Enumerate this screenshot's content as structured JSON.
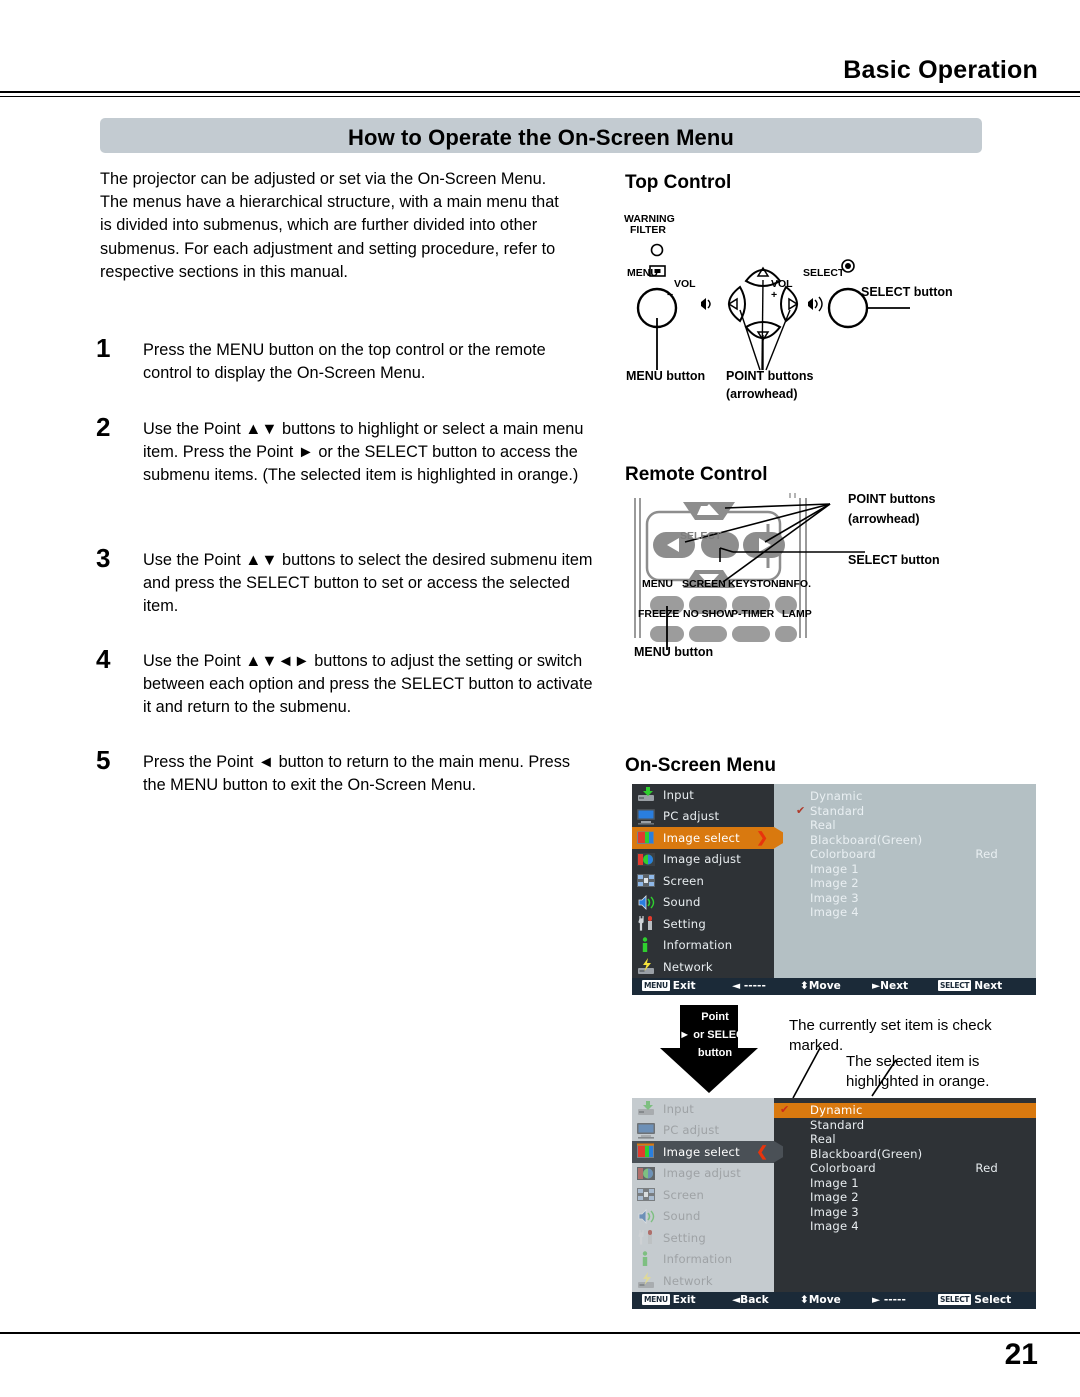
{
  "header": {
    "title": "Basic Operation",
    "banner": "How to Operate the On-Screen Menu"
  },
  "intro": "The projector can be adjusted or set via the On-Screen Menu. The menus have a hierarchical structure, with a main menu that is divided into submenus, which are further divided into other submenus. For each adjustment and setting procedure, refer to respective sections in this manual.",
  "steps": [
    {
      "num": "1",
      "text": "Press the MENU button on the top control or the remote control to display the On-Screen Menu."
    },
    {
      "num": "2",
      "text": "Use the Point ▲▼ buttons to highlight or select a main menu item. Press the Point ► or the SELECT button to access the submenu items. (The selected item is highlighted in orange.)"
    },
    {
      "num": "3",
      "text": "Use the Point ▲▼ buttons to select the desired submenu item and press the SELECT button to set or access the selected item."
    },
    {
      "num": "4",
      "text": "Use the Point  ▲▼◄► buttons to adjust the setting or switch between each option and press the SELECT button to activate it and return to the submenu."
    },
    {
      "num": "5",
      "text": "Press the Point ◄ button to return to the main menu. Press the MENU button to exit the On-Screen Menu."
    }
  ],
  "top_control": {
    "title": "Top Control",
    "warning": "WARNING",
    "filter": "FILTER",
    "menu": "MENU",
    "select": "SELECT",
    "vol_left": "VOL",
    "vol_left_sign": "−",
    "vol_right": "VOL",
    "vol_right_sign": "+",
    "label_select_button": "SELECT button",
    "label_menu_button": "MENU button",
    "label_point_buttons": "POINT buttons",
    "label_arrowhead": "(arrowhead)"
  },
  "remote": {
    "title": "Remote Control",
    "select_text": "SELECT",
    "label_point_buttons": "POINT buttons",
    "label_arrowhead": "(arrowhead)",
    "label_select_button": "SELECT button",
    "label_menu_button": "MENU button",
    "row1": [
      "MENU",
      "SCREEN",
      "KEYSTONE",
      "INFO."
    ],
    "row2": [
      "FREEZE",
      "NO SHOW",
      "P-TIMER",
      "LAMP"
    ]
  },
  "osd": {
    "title": "On-Screen Menu",
    "main_items": [
      {
        "label": "Input",
        "icon": "input-icon"
      },
      {
        "label": "PC adjust",
        "icon": "pc-adjust-icon"
      },
      {
        "label": "Image select",
        "icon": "image-select-icon"
      },
      {
        "label": "Image adjust",
        "icon": "image-adjust-icon"
      },
      {
        "label": "Screen",
        "icon": "screen-icon"
      },
      {
        "label": "Sound",
        "icon": "sound-icon"
      },
      {
        "label": "Setting",
        "icon": "setting-icon"
      },
      {
        "label": "Information",
        "icon": "information-icon"
      },
      {
        "label": "Network",
        "icon": "network-icon"
      }
    ],
    "submenu_items": [
      {
        "label": "Dynamic",
        "value": ""
      },
      {
        "label": "Standard",
        "value": ""
      },
      {
        "label": "Real",
        "value": ""
      },
      {
        "label": "Blackboard(Green)",
        "value": ""
      },
      {
        "label": "Colorboard",
        "value": "Red"
      },
      {
        "label": "Image 1",
        "value": ""
      },
      {
        "label": "Image 2",
        "value": ""
      },
      {
        "label": "Image 3",
        "value": ""
      },
      {
        "label": "Image 4",
        "value": ""
      }
    ],
    "menu1": {
      "highlighted_main": "Image select",
      "checked_sub": "Standard",
      "arrow_glyph": "❯",
      "footer": {
        "exit_key": "MENU",
        "exit": "Exit",
        "left_glyph": "◄",
        "left": "-----",
        "move_glyph": "⬍",
        "move": "Move",
        "next_glyph": "►",
        "next": "Next",
        "select_key": "SELECT",
        "select": "Next"
      }
    },
    "menu2": {
      "highlighted_main": "Image select",
      "highlighted_sub": "Dynamic",
      "checked_sub": "Dynamic",
      "arrow_glyph": "❮",
      "footer": {
        "exit_key": "MENU",
        "exit": "Exit",
        "left_glyph": "◄",
        "left": "Back",
        "move_glyph": "⬍",
        "move": "Move",
        "next_glyph": "►",
        "next": "-----",
        "select_key": "SELECT",
        "select": "Select"
      }
    },
    "callout": {
      "line1": "Point",
      "line2": "► or SELECT",
      "line3": "button"
    },
    "annotation_check": "The currently set item is check marked.",
    "annotation_orange": "The selected item is highlighted in orange."
  },
  "colors": {
    "accent_orange": "#d9790f",
    "menu_dark": "#2e3236",
    "menu_panel_light": "#b4c0c4",
    "menu_footer": "#1b2a38",
    "red_arrow": "#e8340c",
    "banner_gray": "#c3cbd1",
    "inactive_gray": "#c5cbcf"
  },
  "page_number": "21"
}
